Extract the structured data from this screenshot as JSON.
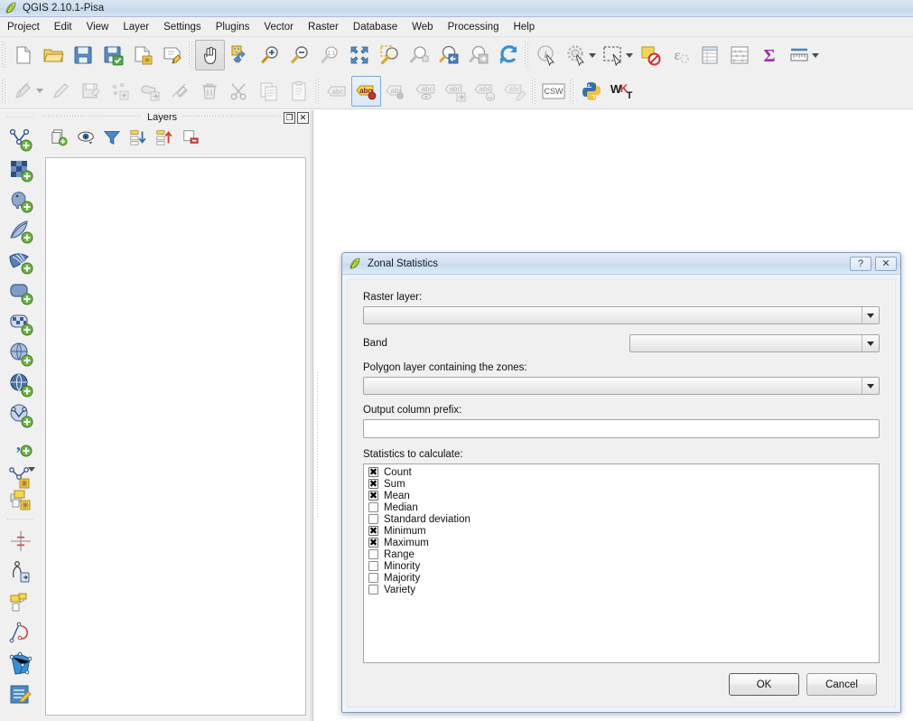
{
  "window": {
    "title": "QGIS 2.10.1-Pisa",
    "app_icon": "qgis-leaf-icon"
  },
  "menubar": {
    "items": [
      {
        "label": "Project"
      },
      {
        "label": "Edit"
      },
      {
        "label": "View"
      },
      {
        "label": "Layer"
      },
      {
        "label": "Settings"
      },
      {
        "label": "Plugins"
      },
      {
        "label": "Vector"
      },
      {
        "label": "Raster"
      },
      {
        "label": "Database"
      },
      {
        "label": "Web"
      },
      {
        "label": "Processing"
      },
      {
        "label": "Help"
      }
    ]
  },
  "toolbar_top": {
    "items": [
      {
        "name": "new-project-icon"
      },
      {
        "name": "open-project-icon"
      },
      {
        "name": "save-project-icon"
      },
      {
        "name": "save-project-as-icon"
      },
      {
        "name": "new-print-composer-icon"
      },
      {
        "name": "composer-manager-icon"
      },
      {
        "name": "pan-map-icon"
      },
      {
        "name": "pan-map-to-selection-icon"
      },
      {
        "name": "zoom-in-icon"
      },
      {
        "name": "zoom-out-icon"
      },
      {
        "name": "zoom-native-resolution-icon"
      },
      {
        "name": "zoom-full-icon"
      },
      {
        "name": "zoom-to-selection-icon"
      },
      {
        "name": "zoom-to-layer-icon"
      },
      {
        "name": "zoom-last-icon"
      },
      {
        "name": "zoom-next-icon"
      },
      {
        "name": "refresh-icon"
      },
      {
        "name": "identify-features-icon"
      },
      {
        "name": "run-feature-action-icon"
      },
      {
        "name": "select-features-icon"
      },
      {
        "name": "deselect-features-icon"
      },
      {
        "name": "select-by-expression-icon"
      },
      {
        "name": "open-attribute-table-icon"
      },
      {
        "name": "field-calculator-icon"
      },
      {
        "name": "statistical-summary-icon"
      },
      {
        "name": "measure-line-icon"
      }
    ]
  },
  "toolbar_second": {
    "items": [
      {
        "name": "current-edits-icon"
      },
      {
        "name": "toggle-editing-icon"
      },
      {
        "name": "save-layer-edits-icon"
      },
      {
        "name": "add-feature-icon"
      },
      {
        "name": "move-feature-icon"
      },
      {
        "name": "node-tool-icon"
      },
      {
        "name": "delete-selected-icon"
      },
      {
        "name": "cut-features-icon"
      },
      {
        "name": "copy-features-icon"
      },
      {
        "name": "paste-features-icon"
      },
      {
        "name": "label-icon"
      },
      {
        "name": "pin-labels-icon"
      },
      {
        "name": "highlight-pinned-labels-icon"
      },
      {
        "name": "show-hide-labels-icon"
      },
      {
        "name": "move-label-icon"
      },
      {
        "name": "rotate-label-icon"
      },
      {
        "name": "change-label-icon"
      },
      {
        "name": "metasearch-csw-icon"
      },
      {
        "name": "python-console-icon"
      },
      {
        "name": "wkt-plugin-icon"
      }
    ]
  },
  "toolbar_left": {
    "items": [
      {
        "name": "add-vector-layer-icon"
      },
      {
        "name": "add-raster-layer-icon"
      },
      {
        "name": "add-postgis-layer-icon"
      },
      {
        "name": "add-spatialite-layer-icon"
      },
      {
        "name": "add-mssql-layer-icon"
      },
      {
        "name": "add-oracle-layer-icon"
      },
      {
        "name": "add-db2-layer-icon"
      },
      {
        "name": "add-wms-layer-icon"
      },
      {
        "name": "add-wcs-layer-icon"
      },
      {
        "name": "add-wfs-layer-icon"
      },
      {
        "name": "add-delimited-text-layer-icon"
      },
      {
        "name": "new-shapefile-layer-icon"
      },
      {
        "name": "new-memory-layer-icon"
      },
      {
        "name": "georeferencer-icon"
      },
      {
        "name": "gps-tools-icon"
      },
      {
        "name": "openstreetmap-icon"
      },
      {
        "name": "topology-checker-icon"
      },
      {
        "name": "spatial-query-icon"
      },
      {
        "name": "raster-editor-icon"
      }
    ]
  },
  "layers_panel": {
    "title": "Layers",
    "float_button": "❐",
    "close_button": "✕",
    "toolbar": [
      {
        "name": "add-group-icon"
      },
      {
        "name": "manage-layer-visibility-icon"
      },
      {
        "name": "filter-legend-icon"
      },
      {
        "name": "expand-all-icon"
      },
      {
        "name": "collapse-all-icon"
      },
      {
        "name": "remove-layer-icon"
      }
    ],
    "tree_items": []
  },
  "dialog": {
    "title": "Zonal Statistics",
    "icon": "qgis-leaf-icon",
    "help_button": "?",
    "close_button": "✕",
    "raster_layer": {
      "label": "Raster layer:",
      "value": "",
      "placeholder": ""
    },
    "band": {
      "label": "Band",
      "value": "",
      "placeholder": ""
    },
    "polygon_layer": {
      "label": "Polygon layer containing the zones:",
      "value": "",
      "placeholder": ""
    },
    "output_prefix": {
      "label": "Output column prefix:",
      "value": "",
      "placeholder": ""
    },
    "statistics": {
      "label": "Statistics to calculate:",
      "items": [
        {
          "label": "Count",
          "checked": true
        },
        {
          "label": "Sum",
          "checked": true
        },
        {
          "label": "Mean",
          "checked": true
        },
        {
          "label": "Median",
          "checked": false
        },
        {
          "label": "Standard deviation",
          "checked": false
        },
        {
          "label": "Minimum",
          "checked": true
        },
        {
          "label": "Maximum",
          "checked": true
        },
        {
          "label": "Range",
          "checked": false
        },
        {
          "label": "Minority",
          "checked": false
        },
        {
          "label": "Majority",
          "checked": false
        },
        {
          "label": "Variety",
          "checked": false
        }
      ],
      "check_mark": "✖"
    },
    "buttons": {
      "ok": "OK",
      "cancel": "Cancel"
    }
  },
  "colors": {
    "titlebar_gradient_top": "#d9e6f2",
    "dialog_border": "#7e9cc0",
    "panel_bg": "#f0f0f0",
    "canvas_bg": "#ffffff",
    "accent_green": "#8db33b",
    "accent_blue": "#3a76bf"
  }
}
